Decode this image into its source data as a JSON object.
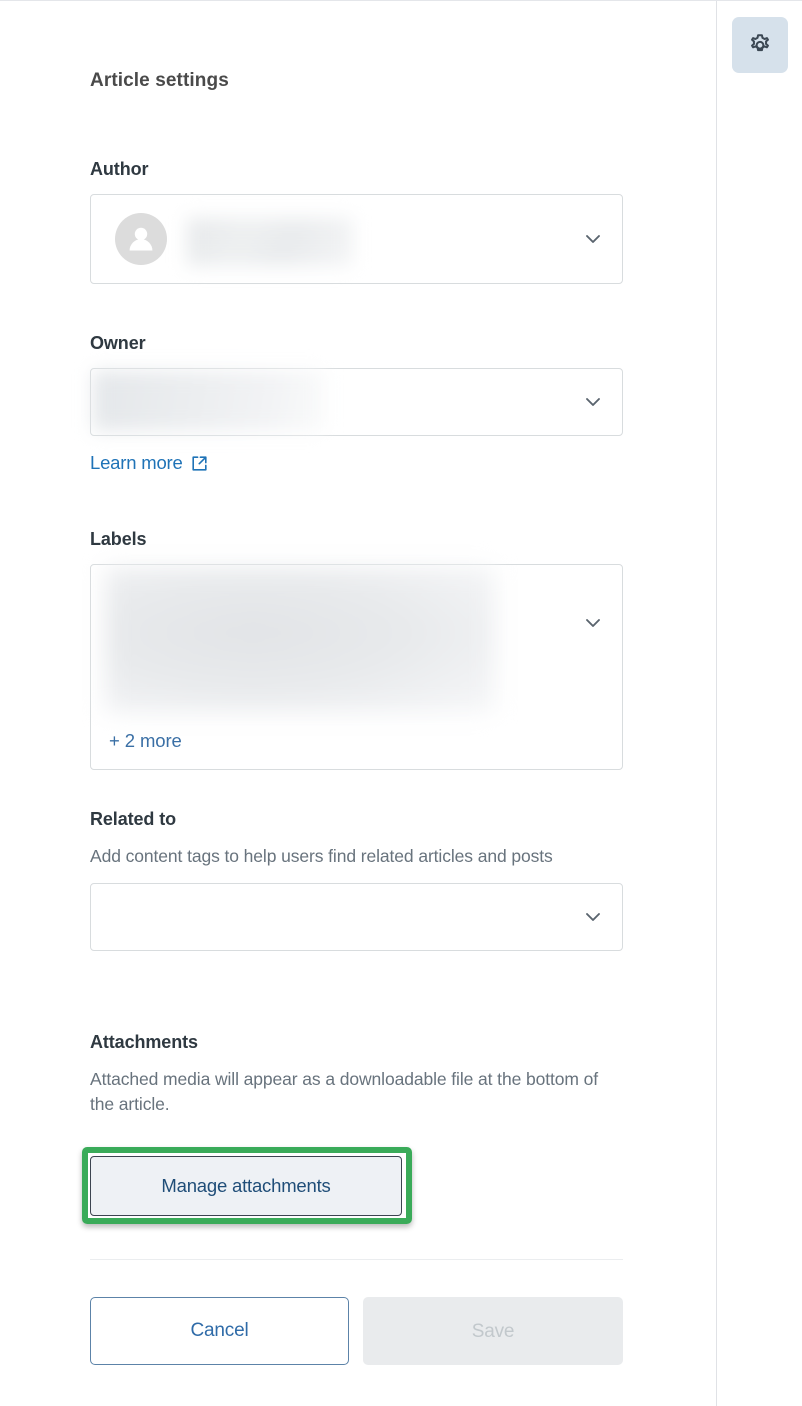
{
  "panel": {
    "title": "Article settings",
    "fields": {
      "author": {
        "label": "Author",
        "value": "",
        "redacted": true,
        "avatar_icon": "person-avatar-icon",
        "chevron_icon": "chevron-down-icon"
      },
      "owner": {
        "label": "Owner",
        "value": "",
        "redacted": true,
        "chevron_icon": "chevron-down-icon",
        "learn_more": "Learn more",
        "learn_more_icon": "external-link-icon"
      },
      "labels": {
        "label": "Labels",
        "value": "",
        "redacted": true,
        "more_label": "+ 2 more",
        "chevron_icon": "chevron-down-icon"
      },
      "related_to": {
        "label": "Related to",
        "description": "Add content tags to help users find related articles and posts",
        "value": "",
        "chevron_icon": "chevron-down-icon"
      },
      "attachments": {
        "label": "Attachments",
        "description": "Attached media will appear as a downloadable file at the bottom of the article.",
        "manage_label": "Manage attachments"
      }
    },
    "footer": {
      "cancel_label": "Cancel",
      "save_label": "Save",
      "save_disabled": true
    }
  },
  "rail": {
    "settings_icon": "gear-icon"
  },
  "colors": {
    "link": "#1f73b7",
    "highlight": "#3aab59",
    "label_text": "#2f3941",
    "muted_text": "#68737d",
    "border": "#d8dcde",
    "gear_bg": "#d6e1eb"
  }
}
